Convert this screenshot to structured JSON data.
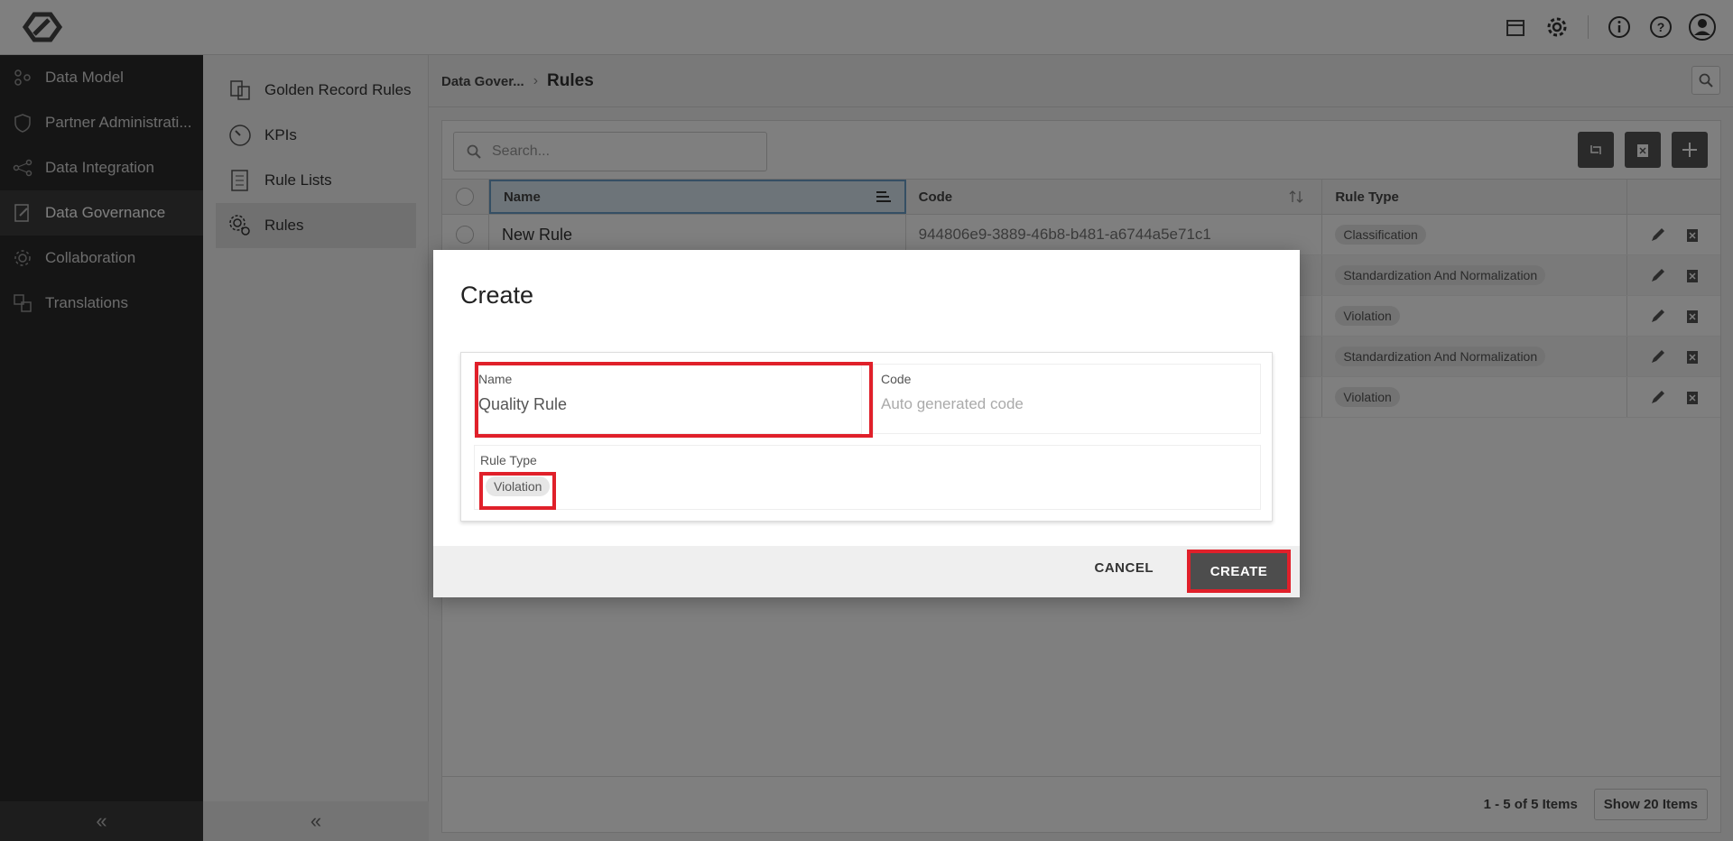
{
  "nav": {
    "items": [
      {
        "label": "Data Model",
        "icon": "data-model-icon"
      },
      {
        "label": "Partner Administrati...",
        "icon": "shield-icon"
      },
      {
        "label": "Data Integration",
        "icon": "integration-icon"
      },
      {
        "label": "Data Governance",
        "icon": "governance-icon"
      },
      {
        "label": "Collaboration",
        "icon": "collaboration-icon"
      },
      {
        "label": "Translations",
        "icon": "translate-icon"
      }
    ],
    "collapse": "«"
  },
  "subnav": {
    "items": [
      {
        "label": "Golden Record Rules",
        "icon": "golden-record-icon"
      },
      {
        "label": "KPIs",
        "icon": "gauge-icon"
      },
      {
        "label": "Rule Lists",
        "icon": "list-icon"
      },
      {
        "label": "Rules",
        "icon": "rules-icon"
      }
    ],
    "collapse": "«"
  },
  "breadcrumb": {
    "parent": "Data Gover...",
    "sep": "›",
    "current": "Rules"
  },
  "grid": {
    "search_placeholder": "Search...",
    "headers": {
      "name": "Name",
      "code": "Code",
      "type": "Rule Type"
    },
    "rows": [
      {
        "name": "New Rule",
        "code": "944806e9-3889-46b8-b481-a6744a5e71c1",
        "type": "Classification"
      },
      {
        "name": "",
        "code": "",
        "type": "Standardization And Normalization"
      },
      {
        "name": "",
        "code": "",
        "type": "Violation"
      },
      {
        "name": "",
        "code": "",
        "type": "Standardization And Normalization"
      },
      {
        "name": "",
        "code": "",
        "type": "Violation"
      }
    ],
    "page_info": "1 - 5 of 5 Items",
    "page_size": "Show 20 Items"
  },
  "dialog": {
    "title": "Create",
    "name_label": "Name",
    "name_value": "Quality Rule",
    "code_label": "Code",
    "code_placeholder": "Auto generated code",
    "type_label": "Rule Type",
    "type_value": "Violation",
    "cancel": "CANCEL",
    "create": "CREATE"
  },
  "colors": {
    "highlight": "#e0202a",
    "sidebar": "#2b2b2b",
    "button": "#4d4d4d"
  }
}
